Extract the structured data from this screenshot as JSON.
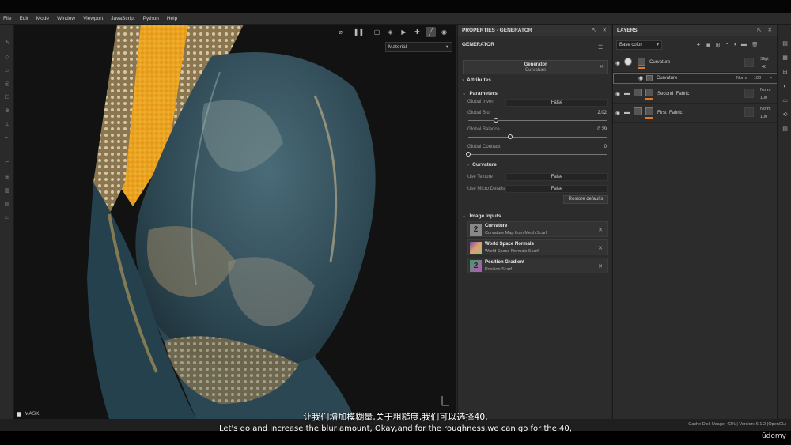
{
  "menu": [
    "File",
    "Edit",
    "Mode",
    "Window",
    "Viewport",
    "JavaScript",
    "Python",
    "Help"
  ],
  "viewport": {
    "material_select": "Material",
    "mask_label": "MASK"
  },
  "properties": {
    "header": "PROPERTIES - GENERATOR",
    "generator_label": "GENERATOR",
    "gen_box_title": "Generator",
    "gen_box_sub": "Curvature",
    "attributes": "Attributes",
    "parameters": "Parameters",
    "global_invert_label": "Global Invert",
    "global_invert_value": "False",
    "global_blur_label": "Global Blur",
    "global_blur_value": "2.02",
    "global_blur_fraction": 0.2,
    "global_balance_label": "Global Balance",
    "global_balance_value": "0.29",
    "global_balance_fraction": 0.3,
    "global_contrast_label": "Global Contrast",
    "global_contrast_value": "0",
    "global_contrast_fraction": 0,
    "curvature_section": "Curvature",
    "use_texture_label": "Use Texture",
    "use_texture_value": "False",
    "use_micro_label": "Use Micro Details",
    "use_micro_value": "False",
    "restore": "Restore defaults",
    "image_inputs": "Image inputs",
    "inputs": [
      {
        "title": "Curvature",
        "sub": "Curvature Map from Mesh Scarf",
        "thumb": "2"
      },
      {
        "title": "World Space Normals",
        "sub": "World Space Normals Scarf",
        "thumb": ""
      },
      {
        "title": "Position Gradient",
        "sub": "Position Scarf",
        "thumb": "2"
      }
    ]
  },
  "layers": {
    "header": "LAYERS",
    "base_color": "Base color",
    "rows": [
      {
        "name": "Curvature",
        "blend": "Sligt",
        "opacity": "40"
      },
      {
        "name": "Curvature",
        "blend": "Norm",
        "opacity": "100"
      },
      {
        "name": "Second_Fabric",
        "blend": "Norm",
        "opacity": "100"
      },
      {
        "name": "First_Fabric",
        "blend": "Norm",
        "opacity": "100"
      }
    ]
  },
  "status": "Cache Disk Usage:   42%  |  Version: 6.1.2 (OpenGL)",
  "subtitles": {
    "zh": "让我们增加模糊量,关于粗糙度,我们可以选择40,",
    "en": "Let's go and increase the blur amount, Okay,and for the roughness,we can go for the 40,"
  },
  "watermark": "ūdemy",
  "colors": {
    "accent": "#e07a2a",
    "panel": "#2c2c2c",
    "cloth": "#2f4a55",
    "gold": "#e8a020"
  }
}
